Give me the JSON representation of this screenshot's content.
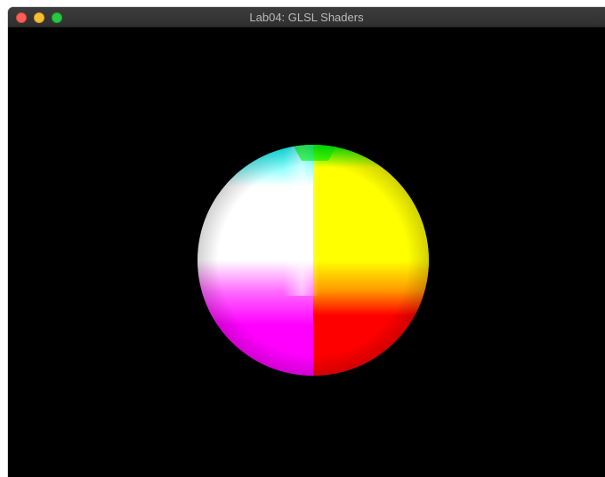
{
  "window": {
    "title": "Lab04: GLSL Shaders"
  },
  "controls": {
    "close_icon": "close-icon",
    "minimize_icon": "minimize-icon",
    "zoom_icon": "zoom-icon"
  },
  "colors": {
    "background": "#000000",
    "titlebar": "#333333",
    "sphere_white": "#ffffff",
    "sphere_yellow": "#ffff00",
    "sphere_magenta": "#ff00ff",
    "sphere_red": "#ff0000",
    "sphere_cyan": "#00ffff",
    "sphere_green": "#00ff00"
  }
}
